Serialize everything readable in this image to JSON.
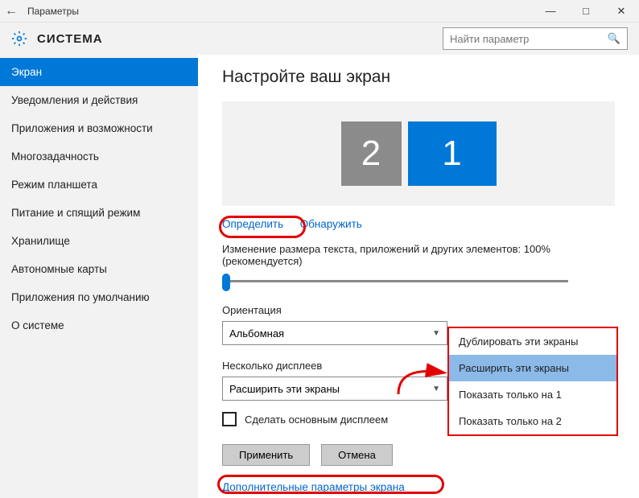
{
  "window": {
    "title": "Параметры"
  },
  "header": {
    "title": "СИСТЕМА"
  },
  "search": {
    "placeholder": "Найти параметр"
  },
  "sidebar": {
    "items": [
      "Экран",
      "Уведомления и действия",
      "Приложения и возможности",
      "Многозадачность",
      "Режим планшета",
      "Питание и спящий режим",
      "Хранилище",
      "Автономные карты",
      "Приложения по умолчанию",
      "О системе"
    ],
    "active_index": 0
  },
  "main": {
    "heading": "Настройте ваш экран",
    "monitors": {
      "m2": "2",
      "m1": "1"
    },
    "identify_link": "Определить",
    "detect_link": "Обнаружить",
    "scale_label": "Изменение размера текста, приложений и других элементов: 100% (рекомендуется)",
    "orientation_label": "Ориентация",
    "orientation_value": "Альбомная",
    "multi_label": "Несколько дисплеев",
    "multi_value": "Расширить эти экраны",
    "primary_check": "Сделать основным дисплеем",
    "apply_btn": "Применить",
    "cancel_btn": "Отмена",
    "advanced_link": "Дополнительные параметры экрана"
  },
  "dropdown": {
    "opt0": "Дублировать эти экраны",
    "opt1": "Расширить эти экраны",
    "opt2": "Показать только на 1",
    "opt3": "Показать только на 2"
  }
}
